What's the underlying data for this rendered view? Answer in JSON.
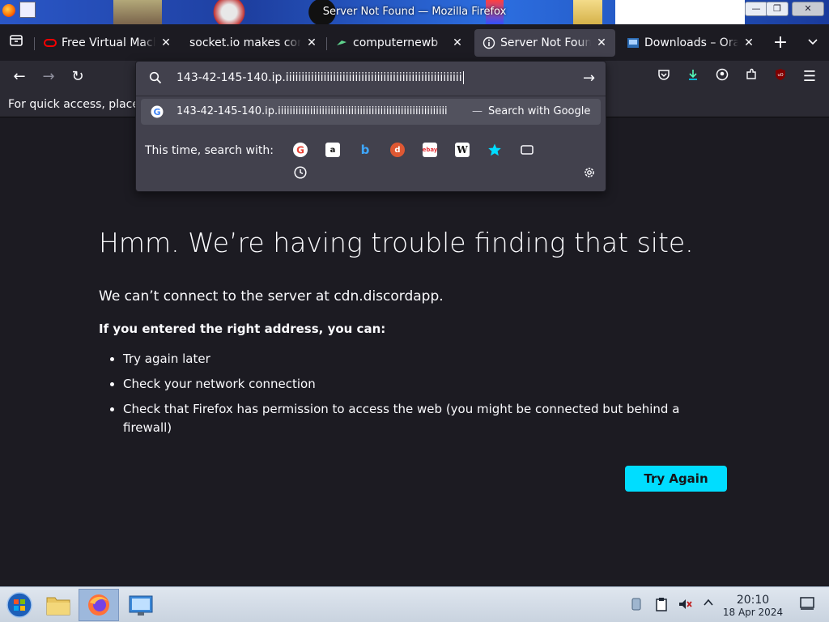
{
  "window": {
    "title": "Server Not Found — Mozilla Firefox",
    "min_symbol": "—",
    "max_symbol": "❐",
    "close_symbol": "✕"
  },
  "tabs": [
    {
      "label": "Free Virtual Machi",
      "favicon": "oracle-icon",
      "active": false
    },
    {
      "label": "socket.io makes comp",
      "favicon": "none",
      "active": false
    },
    {
      "label": "computernewb",
      "favicon": "bird-icon",
      "active": false
    },
    {
      "label": "Server Not Found",
      "favicon": "info-icon",
      "active": true
    },
    {
      "label": "Downloads – Orac",
      "favicon": "vm-icon",
      "active": false
    }
  ],
  "tab_close_symbol": "✕",
  "new_tab_symbol": "+",
  "tab_list_symbol": "⌄",
  "nav": {
    "back": "←",
    "forward": "→",
    "reload": "↻",
    "menu": "☰"
  },
  "bookmarks_hint": "For quick access, place",
  "urlbar": {
    "value": "143-42-145-140.ip.iiiiiiiiiiiiiiiiiiiiiiiiiiiiiiiiiiiiiiiiiiiiiiiiiiiiiiii",
    "go": "→",
    "suggestion_text": "143-42-145-140.ip.iiiiiiiiiiiiiiiiiiiiiiiiiiiiiiiiiiiiiiiiiiiiiiiiiiiiiiiiii",
    "suggestion_dash": "—",
    "suggestion_action": "Search with Google",
    "oneoff_label": "This time, search with:",
    "engines": [
      "google-icon",
      "amazon-icon",
      "bing-icon",
      "duckduckgo-icon",
      "ebay-icon",
      "wikipedia-icon",
      "bookmarks-star-icon",
      "tabs-icon",
      "history-icon"
    ]
  },
  "error": {
    "title": "Hmm. We’re having trouble finding that site.",
    "description": "We can’t connect to the server at cdn.discordapp.",
    "lead": "If you entered the right address, you can:",
    "items": [
      "Try again later",
      "Check your network connection",
      "Check that Firefox has permission to access the web (you might be connected but behind a firewall)"
    ],
    "button": "Try Again"
  },
  "colors": {
    "accent": "#00ddff",
    "page_bg": "#1c1b22",
    "toolbar_bg": "#2b2a33",
    "panel_bg": "#42414d"
  },
  "taskbar": {
    "time": "20:10",
    "date": "18 Apr 2024"
  }
}
